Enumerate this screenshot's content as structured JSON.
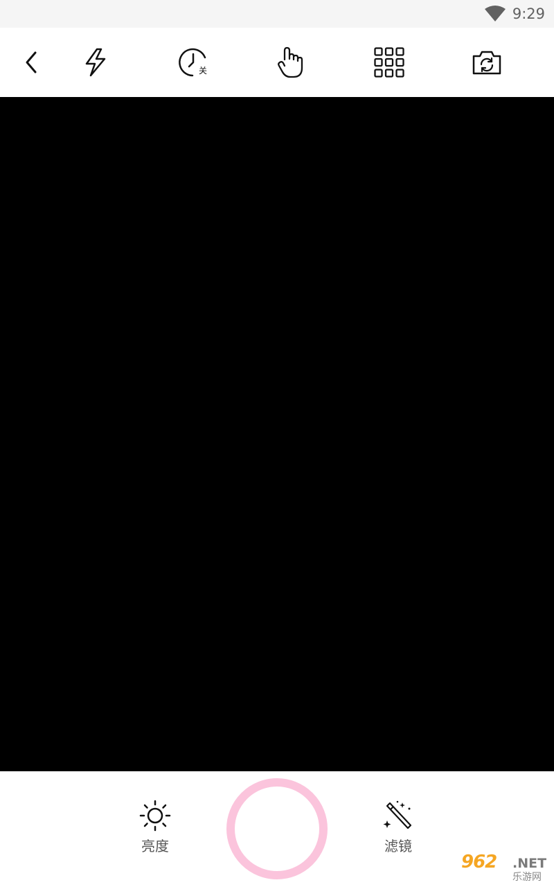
{
  "status_bar": {
    "time": "9:29",
    "wifi_icon": "wifi-icon"
  },
  "toolbar": {
    "items": [
      {
        "icon": "back-chevron-icon"
      },
      {
        "icon": "flash-icon"
      },
      {
        "icon": "timer-icon",
        "badge": "关"
      },
      {
        "icon": "touch-shutter-icon"
      },
      {
        "icon": "grid-icon"
      },
      {
        "icon": "switch-camera-icon"
      }
    ]
  },
  "bottom_bar": {
    "brightness": {
      "label": "亮度",
      "icon": "brightness-icon"
    },
    "filter": {
      "label": "滤镜",
      "icon": "magic-wand-icon"
    },
    "shutter": {
      "icon": "shutter-button",
      "color": "#fbc4dc"
    }
  },
  "watermark": {
    "brand": "962",
    "suffix": ".NET",
    "subtitle": "乐游网"
  },
  "colors": {
    "viewfinder": "#000000",
    "shutter_ring": "#fbc4dc",
    "status_bar": "#f5f5f5"
  }
}
